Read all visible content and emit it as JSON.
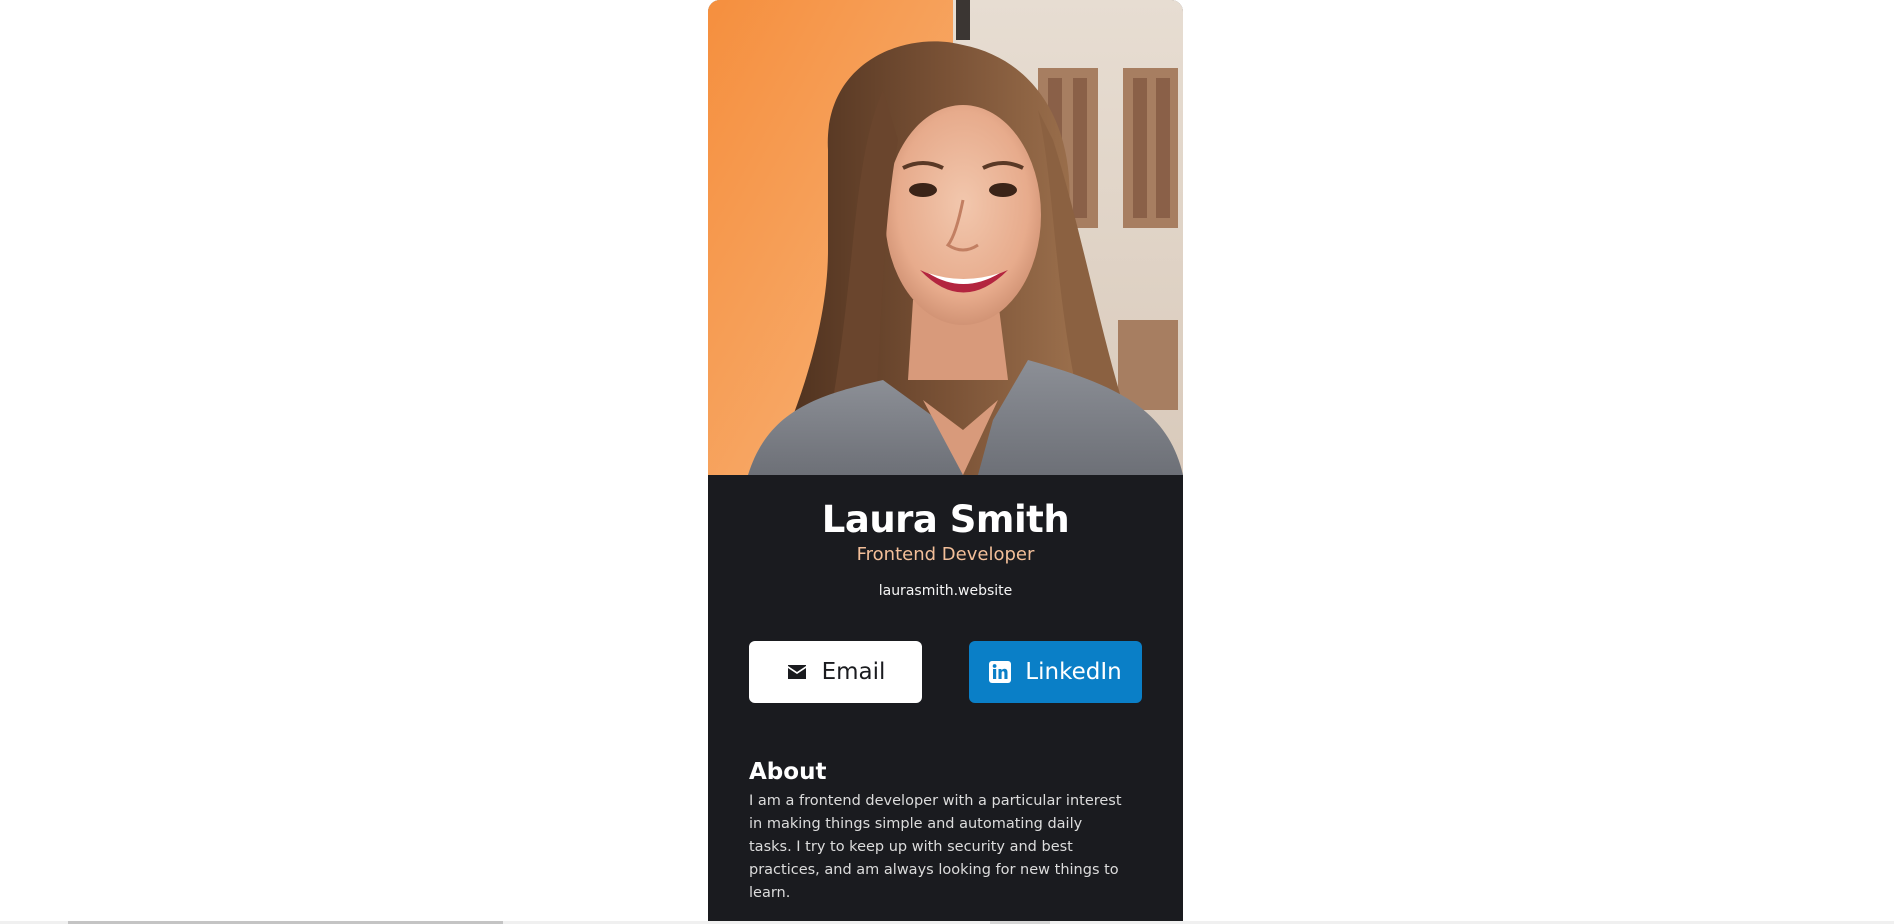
{
  "profile": {
    "name": "Laura Smith",
    "role": "Frontend Developer",
    "website": "laurasmith.website"
  },
  "buttons": {
    "email_label": "Email",
    "email_icon": "envelope-icon",
    "linkedin_label": "LinkedIn",
    "linkedin_icon": "linkedin-icon"
  },
  "about": {
    "heading": "About",
    "body": "I am a frontend developer with a particular interest in making things simple and automating daily tasks. I try to keep up with security and best practices, and am always looking for new things to learn."
  },
  "colors": {
    "card_background": "#1a1b1f",
    "role_accent": "#f3bf99",
    "linkedin_blue": "#0a7fc7",
    "page_background": "#ffffff"
  }
}
